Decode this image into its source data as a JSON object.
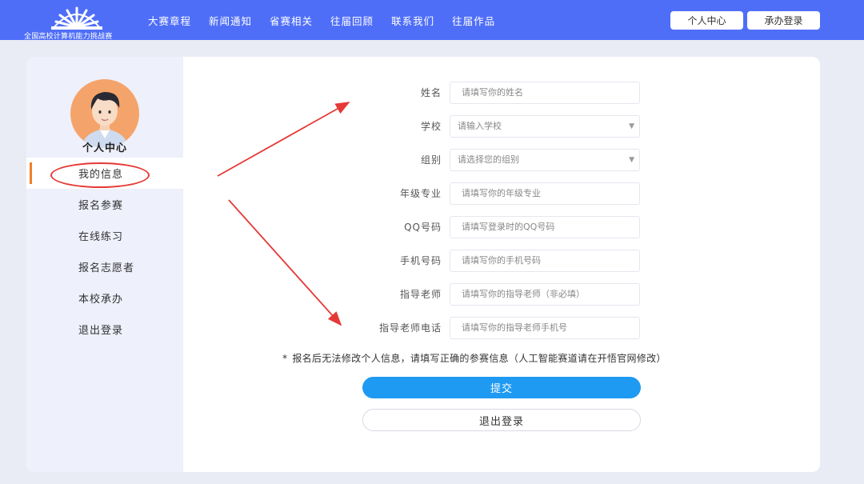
{
  "header": {
    "logo_text": "全国高校计算机能力挑战赛",
    "nav": [
      "大赛章程",
      "新闻通知",
      "省赛相关",
      "往届回顾",
      "联系我们",
      "往届作品"
    ],
    "personal_center_button": "个人中心",
    "host_login_button": "承办登录"
  },
  "sidebar": {
    "title": "个人中心",
    "items": [
      {
        "label": "我的信息"
      },
      {
        "label": "报名参赛"
      },
      {
        "label": "在线练习"
      },
      {
        "label": "报名志愿者"
      },
      {
        "label": "本校承办"
      },
      {
        "label": "退出登录"
      }
    ]
  },
  "form": {
    "fields": [
      {
        "label": "姓名",
        "placeholder": "请填写你的姓名"
      },
      {
        "label": "学校",
        "placeholder": "请输入学校"
      },
      {
        "label": "组别",
        "placeholder": "请选择您的组别"
      },
      {
        "label": "年级专业",
        "placeholder": "请填写你的年级专业"
      },
      {
        "label": "QQ号码",
        "placeholder": "请填写登录时的QQ号码"
      },
      {
        "label": "手机号码",
        "placeholder": "请填写你的手机号码"
      },
      {
        "label": "指导老师",
        "placeholder": "请填写你的指导老师（非必填）"
      },
      {
        "label": "指导老师电话",
        "placeholder": "请填写你的指导老师手机号"
      }
    ],
    "note_star": "*",
    "note": "报名后无法修改个人信息，请填写正确的参赛信息（人工智能赛道请在开悟官网修改）",
    "submit_label": "提交",
    "logout_label": "退出登录"
  },
  "colors": {
    "header_bg": "#4f6ef7",
    "accent": "#1e9af2",
    "annotation_red": "#e53935",
    "active_indicator": "#f0802b"
  }
}
